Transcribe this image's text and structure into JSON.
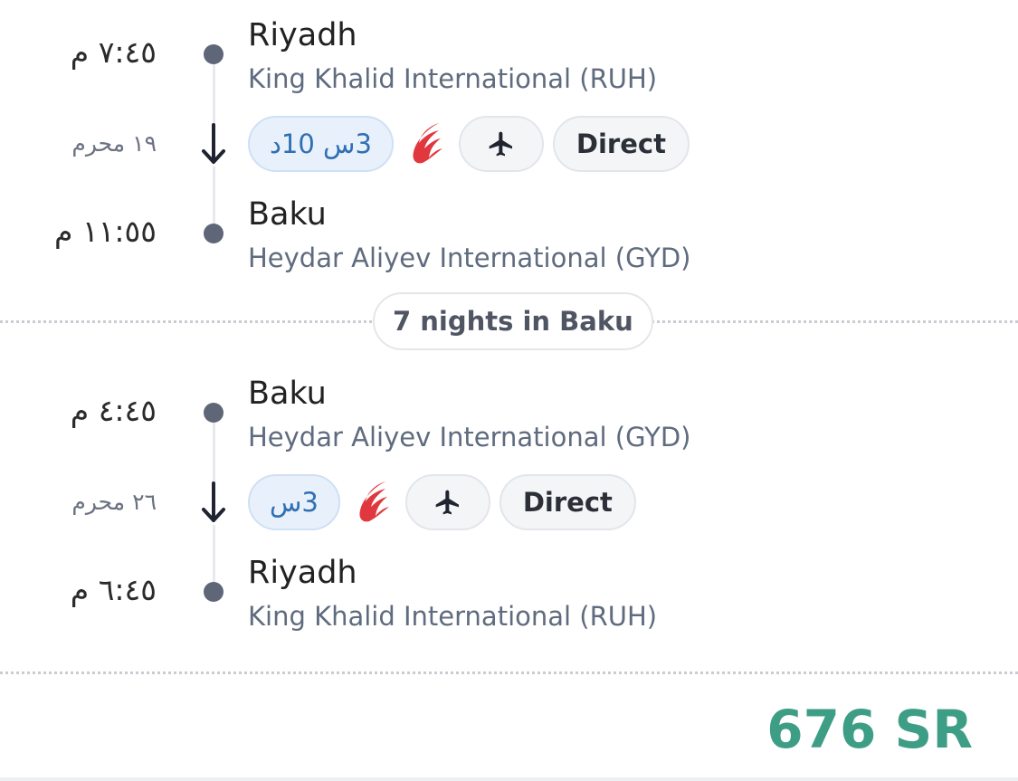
{
  "outbound": {
    "depart_time": "٧:٤٥ م",
    "date": "١٩ محرم",
    "arrive_time": "١١:٥٥ م",
    "origin_city": "Riyadh",
    "origin_airport": "King Khalid International (RUH)",
    "destination_city": "Baku",
    "destination_airport": "Heydar Aliyev International (GYD)",
    "duration": "3س 10د",
    "airline_icon": "airline-bird-logo",
    "aircraft_icon": "airplane-icon",
    "stops": "Direct"
  },
  "stay": {
    "label": "7 nights in Baku"
  },
  "return": {
    "depart_time": "٤:٤٥ م",
    "date": "٢٦ محرم",
    "arrive_time": "٦:٤٥ م",
    "origin_city": "Baku",
    "origin_airport": "Heydar Aliyev International (GYD)",
    "destination_city": "Riyadh",
    "destination_airport": "King Khalid International (RUH)",
    "duration": "3س",
    "airline_icon": "airline-bird-logo",
    "aircraft_icon": "airplane-icon",
    "stops": "Direct"
  },
  "price": "676 SR",
  "colors": {
    "price": "#3e9e85",
    "duration_chip_bg": "#e8f1fb",
    "duration_text": "#2f6fb3",
    "airline_logo": "#e0383e",
    "timeline_dot": "#5e6677"
  }
}
